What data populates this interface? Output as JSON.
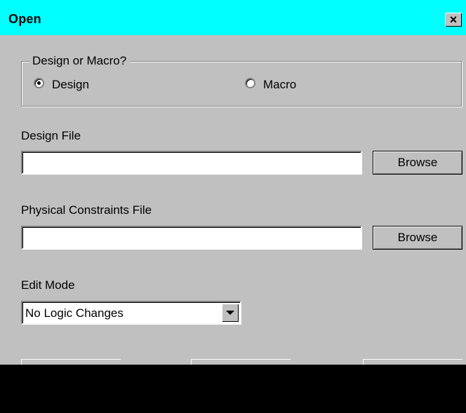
{
  "dialog": {
    "title": "Open",
    "close_glyph": "×"
  },
  "group": {
    "legend": "Design or Macro?",
    "options": [
      {
        "label": "Design",
        "selected": true
      },
      {
        "label": "Macro",
        "selected": false
      }
    ]
  },
  "design_file": {
    "label": "Design File",
    "value": "",
    "browse_label": "Browse"
  },
  "constraints_file": {
    "label": "Physical Constraints File",
    "value": "",
    "browse_label": "Browse"
  },
  "edit_mode": {
    "label": "Edit Mode",
    "selected": "No Logic Changes"
  }
}
